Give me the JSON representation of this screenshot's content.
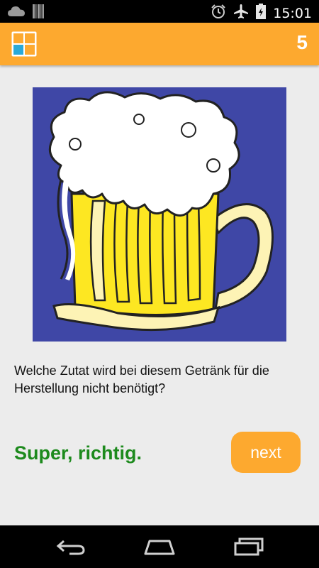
{
  "status_bar": {
    "time": "15:01",
    "icons": [
      "cloud-icon",
      "barcode-icon",
      "alarm-icon",
      "airplane-mode-icon",
      "battery-icon"
    ]
  },
  "action_bar": {
    "score": "5",
    "logo_icon": "app-logo-grid-icon"
  },
  "question": {
    "image_subject": "beer-mug-icon",
    "text": "Welche Zutat wird bei diesem Getränk für die Herstellung nicht benötigt?"
  },
  "feedback": {
    "text": "Super, richtig."
  },
  "next_button": {
    "label": "next"
  },
  "navigation": {
    "buttons": [
      "back-icon",
      "home-icon",
      "recent-apps-icon"
    ]
  },
  "colors": {
    "accent": "#fda92f",
    "success": "#1d8a1d",
    "image_background": "#3f47a6",
    "beer": "#fde722",
    "foam": "#ffffff"
  }
}
